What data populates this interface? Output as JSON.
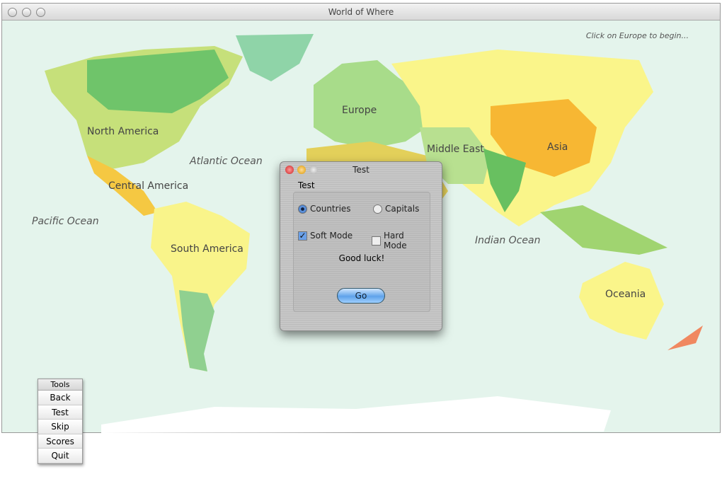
{
  "window": {
    "title": "World of Where"
  },
  "map": {
    "hint": "Click on Europe to begin...",
    "regions": [
      "North America",
      "Central America",
      "South America",
      "Europe",
      "Middle East",
      "Asia",
      "Oceania"
    ],
    "oceans": [
      "Atlantic Ocean",
      "Pacific Ocean",
      "Indian Ocean"
    ]
  },
  "dialog": {
    "title": "Test",
    "group_label": "Test",
    "options": {
      "countries": "Countries",
      "capitals": "Capitals",
      "soft": "Soft Mode",
      "hard": "Hard Mode"
    },
    "selected_mode": "Countries",
    "soft_checked": true,
    "hard_checked": false,
    "message": "Good luck!",
    "go": "Go"
  },
  "tools": {
    "title": "Tools",
    "buttons": [
      "Back",
      "Test",
      "Skip",
      "Scores",
      "Quit"
    ]
  }
}
